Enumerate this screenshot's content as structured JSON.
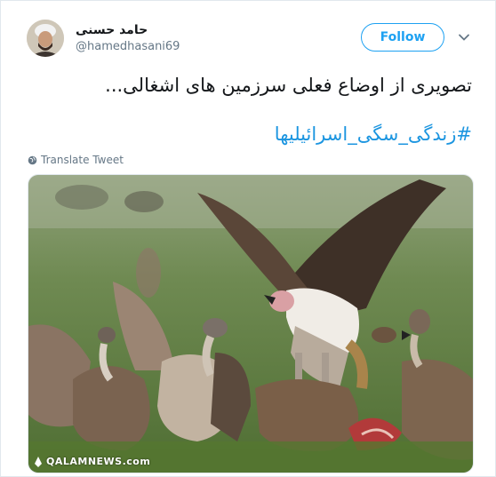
{
  "tweet": {
    "author_name": "حامد حسنی",
    "handle": "@hamedhasani69",
    "follow_label": "Follow",
    "text": "تصویری از اوضاع فعلی سرزمین های اشغالی...",
    "hashtag": "#زندگی_سگی_اسرائیلیها",
    "translate_label": "Translate Tweet",
    "media_watermark": "QALAMNEWS.com"
  },
  "colors": {
    "accent": "#1da1f2",
    "hashtag": "#1b95e0",
    "secondary_text": "#657786"
  },
  "icons": {
    "menu": "chevron-down-icon",
    "translate": "globe-icon"
  }
}
